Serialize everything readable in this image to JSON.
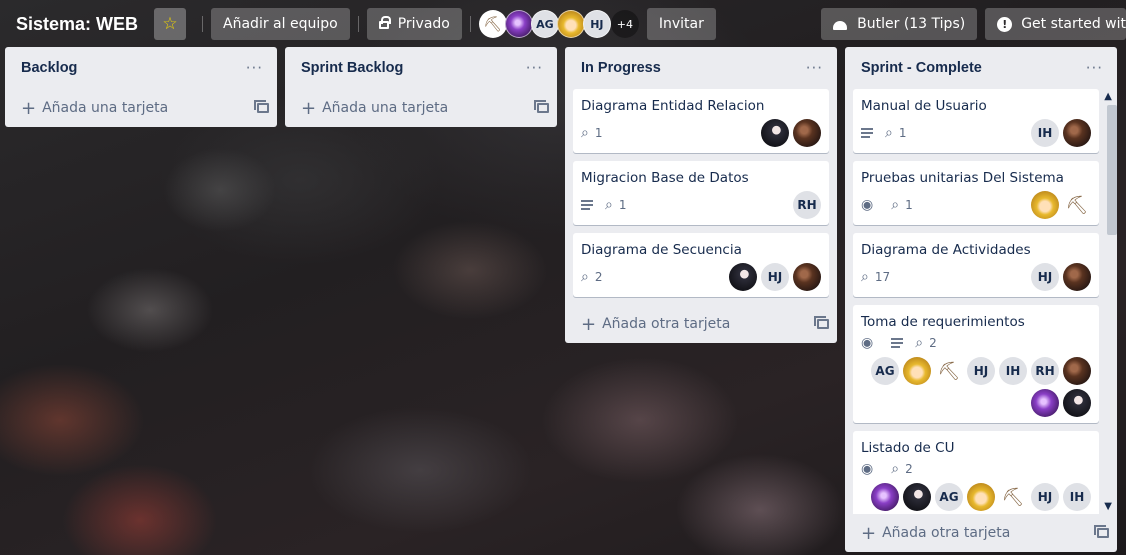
{
  "header": {
    "board_title": "Sistema: WEB",
    "add_team": "Añadir al equipo",
    "privacy": "Privado",
    "members_more": "+4",
    "invite": "Invitar",
    "butler": "Butler (13 Tips)",
    "get_started": "Get started wit",
    "members": [
      {
        "type": "tool",
        "label": "⛏"
      },
      {
        "type": "photo-purple",
        "label": ""
      },
      {
        "type": "initials",
        "label": "AG"
      },
      {
        "type": "photo-yellow",
        "label": ""
      },
      {
        "type": "initials",
        "label": "HJ"
      }
    ]
  },
  "lists": {
    "backlog": {
      "title": "Backlog",
      "menu": "···",
      "add_label": "Añada una tarjeta"
    },
    "sprint_backlog": {
      "title": "Sprint Backlog",
      "menu": "···",
      "add_label": "Añada una tarjeta"
    },
    "in_progress": {
      "title": "In Progress",
      "menu": "···",
      "add_label": "Añada otra tarjeta",
      "cards": [
        {
          "title": "Diagrama Entidad Relacion",
          "attachments": "1"
        },
        {
          "title": "Migracion Base de Datos",
          "attachments": "1",
          "member": "RH"
        },
        {
          "title": "Diagrama de Secuencia",
          "attachments": "2",
          "member": "HJ"
        }
      ]
    },
    "sprint_complete": {
      "title": "Sprint - Complete",
      "menu": "···",
      "add_label": "Añada otra tarjeta",
      "cards": [
        {
          "title": "Manual de Usuario",
          "attachments": "1",
          "member": "IH"
        },
        {
          "title": "Pruebas unitarias Del Sistema",
          "attachments": "1"
        },
        {
          "title": "Diagrama de Actividades",
          "attachments": "17",
          "member": "HJ"
        },
        {
          "title": "Toma de requerimientos",
          "attachments": "2",
          "members": [
            "AG",
            "HJ",
            "IH",
            "RH"
          ]
        },
        {
          "title": "Listado de CU",
          "attachments": "2",
          "members": [
            "AG",
            "HJ",
            "IH"
          ]
        }
      ]
    }
  },
  "icons": {
    "star": "star-icon",
    "attachment": "paperclip-icon",
    "description": "description-icon",
    "watch": "eye-icon",
    "template": "card-template-icon"
  },
  "colors": {
    "star": "#f2d600",
    "list_bg": "#ebecf0",
    "card_bg": "#ffffff"
  }
}
